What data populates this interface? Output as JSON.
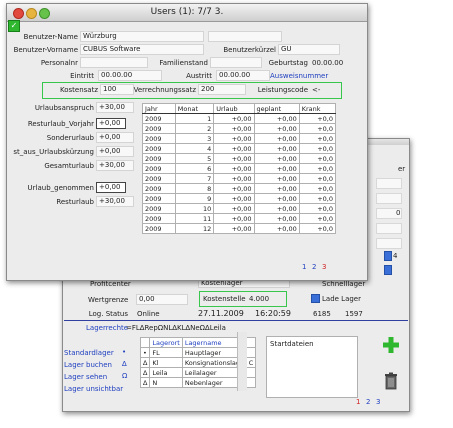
{
  "front": {
    "title": "Users (1): 7/7 3.",
    "name_label": "Benutzer-Name",
    "name_value": "Würzburg",
    "vorname_label": "Benutzer-Vorname",
    "vorname_value": "CUBUS Software",
    "kuerzel_label": "Benutzerkürzel",
    "kuerzel_value": "GU",
    "personalnr_label": "Personalnr",
    "familienstand_label": "Familienstand",
    "geburtstag_label": "Geburtstag",
    "geburtstag_value": "00.00.00",
    "eintritt_label": "Eintritt",
    "eintritt_value": "00.00.00",
    "austritt_label": "Austritt",
    "austritt_value": "00.00.00",
    "ausweis_link": "Ausweisnummer",
    "kostensatz_label": "Kostensatz",
    "kostensatz_value": "100",
    "verrechnung_label": "Verrechnungssatz",
    "verrechnung_value": "200",
    "leistungscode_label": "Leistungscode",
    "leistungscode_value": "<-",
    "left_fields": [
      {
        "label": "Urlaubsanspruch",
        "value": "+30,00"
      },
      {
        "label": "Resturlaub_Vorjahr",
        "value": "+0,00"
      },
      {
        "label": "Sonderurlaub",
        "value": "+0,00"
      },
      {
        "label": "st_aus_Urlaubskürzung",
        "value": "+0,00"
      },
      {
        "label": "Gesamturlaub",
        "value": "+30,00"
      },
      {
        "label": "Urlaub_genommen",
        "value": "+0,00"
      },
      {
        "label": "Resturlaub",
        "value": "+30,00"
      }
    ],
    "table": {
      "headers": [
        "Jahr",
        "Monat",
        "Urlaub",
        "geplant",
        "Krank"
      ],
      "rows": [
        [
          "2009",
          "1",
          "+0,00",
          "+0,00",
          "+0,0"
        ],
        [
          "2009",
          "2",
          "+0,00",
          "+0,00",
          "+0,0"
        ],
        [
          "2009",
          "3",
          "+0,00",
          "+0,00",
          "+0,0"
        ],
        [
          "2009",
          "4",
          "+0,00",
          "+0,00",
          "+0,0"
        ],
        [
          "2009",
          "5",
          "+0,00",
          "+0,00",
          "+0,0"
        ],
        [
          "2009",
          "6",
          "+0,00",
          "+0,00",
          "+0,0"
        ],
        [
          "2009",
          "7",
          "+0,00",
          "+0,00",
          "+0,0"
        ],
        [
          "2009",
          "8",
          "+0,00",
          "+0,00",
          "+0,0"
        ],
        [
          "2009",
          "9",
          "+0,00",
          "+0,00",
          "+0,0"
        ],
        [
          "2009",
          "10",
          "+0,00",
          "+0,00",
          "+0,0"
        ],
        [
          "2009",
          "11",
          "+0,00",
          "+0,00",
          "+0,0"
        ],
        [
          "2009",
          "12",
          "+0,00",
          "+0,00",
          "+0,0"
        ]
      ]
    },
    "pages": [
      "1",
      "2",
      "3"
    ]
  },
  "back": {
    "profitcenter_label": "Profitcenter",
    "kostenlager_value": "Kostenlager",
    "schnelllager_label": "Schnelllager",
    "wertgrenze_label": "Wertgrenze",
    "wertgrenze_value": "0,00",
    "kostenstelle_label": "Kostenstelle",
    "kostenstelle_value": "4.000",
    "ladelager_label": "Lade Lager",
    "log_label": "Log. Status",
    "log_value": "Online",
    "log_date": "27.11.2009",
    "log_time": "16:20:59",
    "log_n1": "6185",
    "log_n2": "1597",
    "lagerrechte_label": "Lagerrechte",
    "lagerrechte_value": "=FL∆RepΩNL∆KL∆NeΩ∆Leila",
    "links": [
      "Standardlager",
      "Lager buchen",
      "Lager sehen",
      "Lager unsichtbar"
    ],
    "lager_headers": [
      "Lagerort",
      "Lagername"
    ],
    "lager_rows": [
      [
        "•",
        "FL",
        "Hauptlager"
      ],
      [
        "∆",
        "Kl",
        "Konsignationslager C"
      ],
      [
        "∆",
        "Leila",
        "Leilalager"
      ],
      [
        "∆",
        "N",
        "Nebenlager"
      ]
    ],
    "startdateien_label": "Startdateien",
    "pages": [
      "1",
      "2",
      "3"
    ],
    "right_frag_1": "er",
    "right_frag_2": "0",
    "right_frag_3": "4"
  },
  "colors": {
    "green": "#39c64d",
    "link_blue": "#2040c0",
    "page_red": "#d02020",
    "plus_green": "#2fb82f"
  }
}
